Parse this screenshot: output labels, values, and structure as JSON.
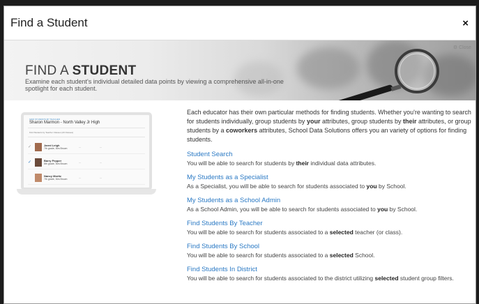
{
  "modal": {
    "title": "Find a Student",
    "close": "×"
  },
  "hero": {
    "title_a": "FIND A ",
    "title_b": "STUDENT",
    "subtitle": "Examine each student's individual detailed data points by viewing a comprehensive all-in-one spotlight for each student.",
    "close_label": "Close"
  },
  "laptop_preview": {
    "header_small": "FIND STUDENTS BY TEACHER",
    "teacher": "Sharon Marmon - North Valley Jr High",
    "filter": "Find Students by Teacher Classes (All Classes)",
    "rows": [
      {
        "check": "✓",
        "name": "Jared Leigh",
        "meta": "7th grade, Mrs Brown"
      },
      {
        "check": "✓",
        "name": "Barry Pepper",
        "meta": "8th grade, Mrs Brown"
      },
      {
        "check": "",
        "name": "Nancy Moritz",
        "meta": "7th grade, Mrs Brown"
      }
    ]
  },
  "content": {
    "intro": [
      "Each educator has their own particular methods for finding students. Whether you're wanting to search for students individually, group students by ",
      "your",
      " attributes, group students by ",
      "their",
      " attributes, or group students by a ",
      "coworkers",
      " attributes, School Data Solutions offers you an variety of options for finding students."
    ],
    "sections": [
      {
        "title": "Student Search",
        "desc_pre": "You will be able to search for students by ",
        "desc_bold": "their",
        "desc_post": " individual data attributes."
      },
      {
        "title": "My Students as a Specialist",
        "desc_pre": "As a Specialist, you will be able to search for students associated to ",
        "desc_bold": "you",
        "desc_post": " by School."
      },
      {
        "title": "My Students as a School Admin",
        "desc_pre": "As a School Admin, you will be able to search for students associated to ",
        "desc_bold": "you",
        "desc_post": " by School."
      },
      {
        "title": "Find Students By Teacher",
        "desc_pre": "You will be able to search for students associated to a ",
        "desc_bold": "selected",
        "desc_post": " teacher (or class)."
      },
      {
        "title": "Find Students By School",
        "desc_pre": "You will be able to search for students associated to a ",
        "desc_bold": "selected",
        "desc_post": " School."
      },
      {
        "title": "Find Students In District",
        "desc_pre": "You will be able to search for students associated to the district utilizing ",
        "desc_bold": "selected",
        "desc_post": " student group filters."
      }
    ]
  }
}
